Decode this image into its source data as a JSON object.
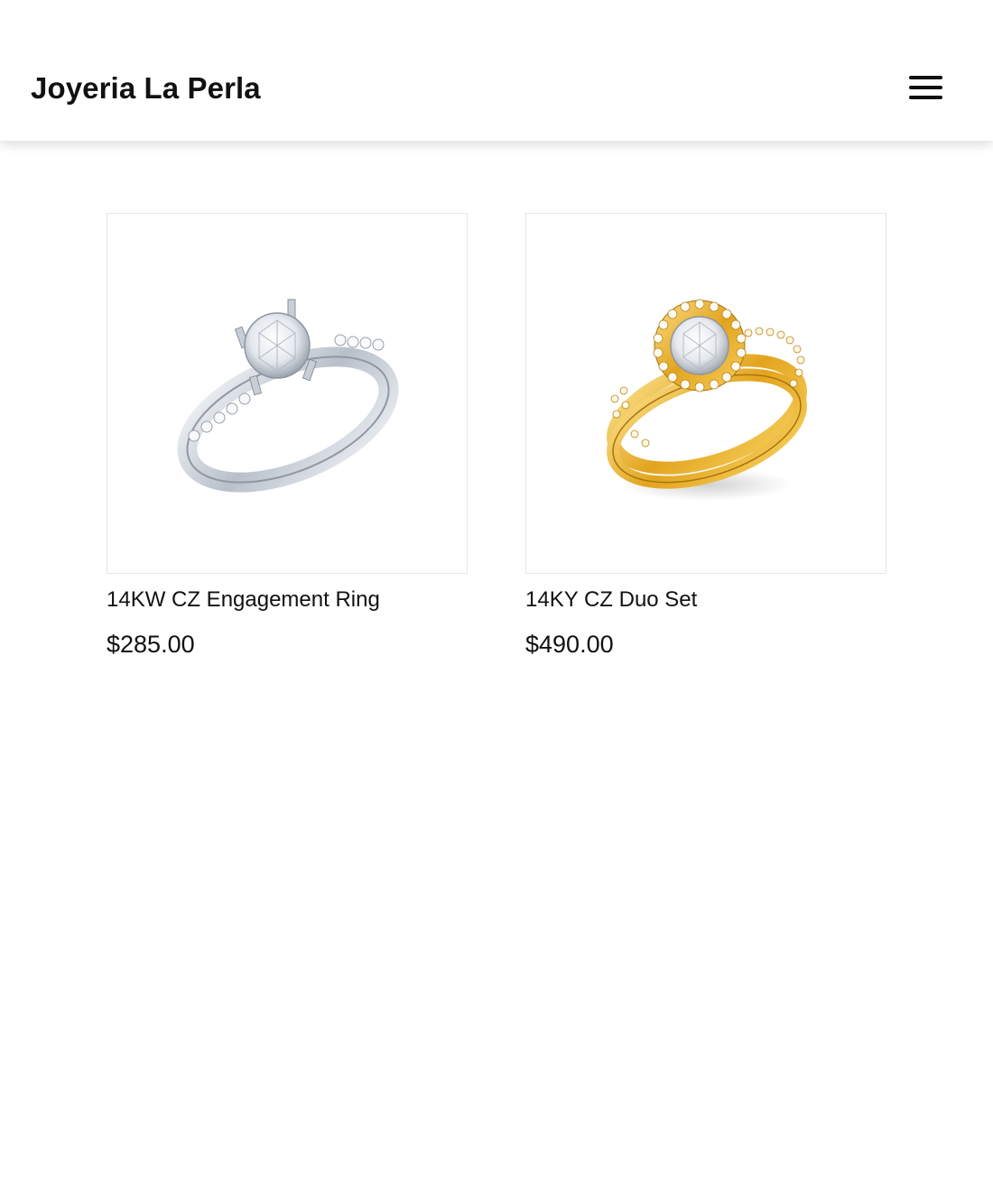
{
  "header": {
    "brand": "Joyeria La Perla",
    "menu_icon": "hamburger-menu-icon"
  },
  "products": [
    {
      "name": "14KW CZ Engagement Ring",
      "price": "$285.00",
      "metal_color": "#d9dde3"
    },
    {
      "name": "14KY CZ Duo Set",
      "price": "$490.00",
      "metal_color": "#e8b430"
    }
  ]
}
